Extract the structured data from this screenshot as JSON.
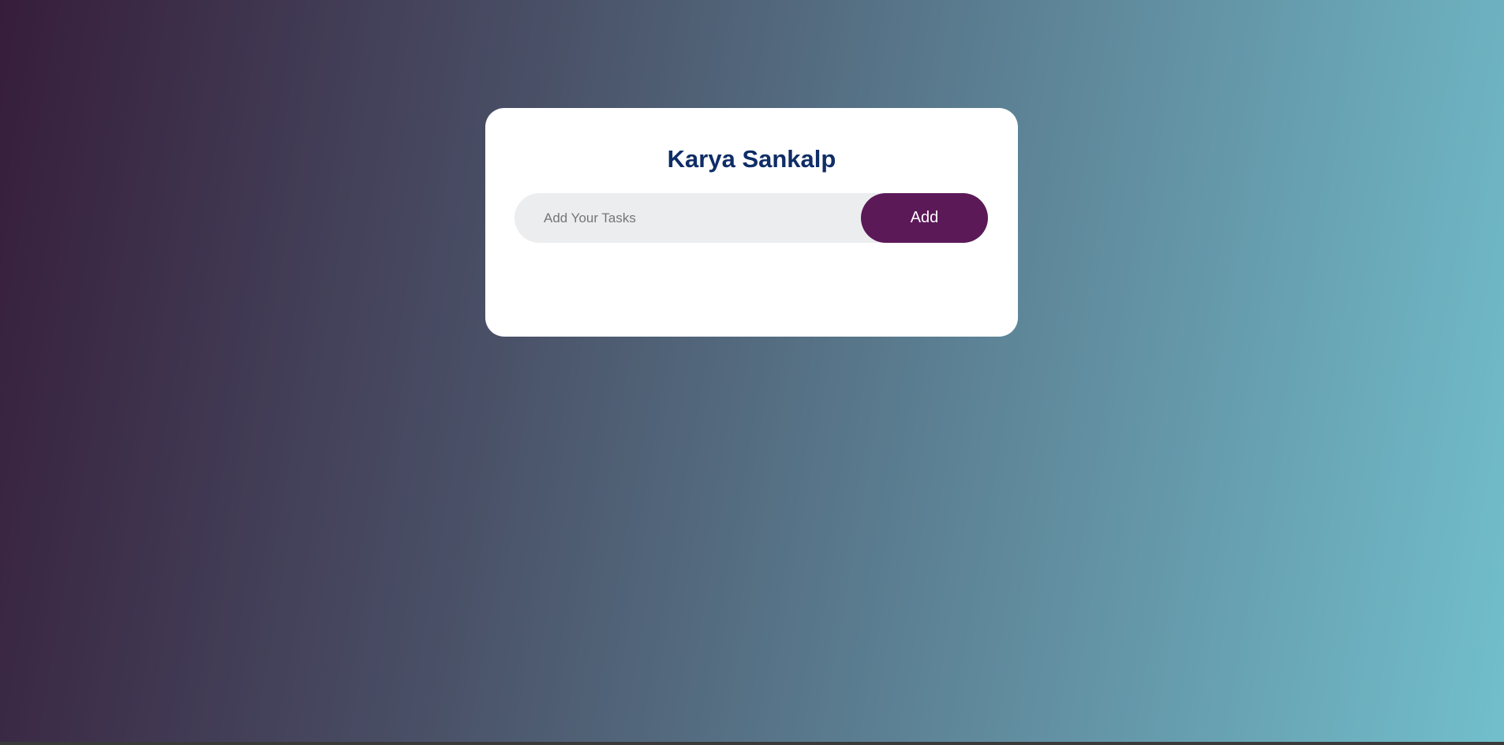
{
  "app": {
    "title": "Karya Sankalp"
  },
  "task_form": {
    "input_value": "",
    "input_placeholder": "Add Your Tasks",
    "add_label": "Add"
  },
  "tasks": [],
  "colors": {
    "background_gradient": [
      "#361d3b",
      "#4a5268",
      "#5e8598",
      "#72bfcc"
    ],
    "card": "#ffffff",
    "title": "#0f2d66",
    "input_background": "#ecedef",
    "button": "#5c1958",
    "button_text": "#ffffff"
  }
}
